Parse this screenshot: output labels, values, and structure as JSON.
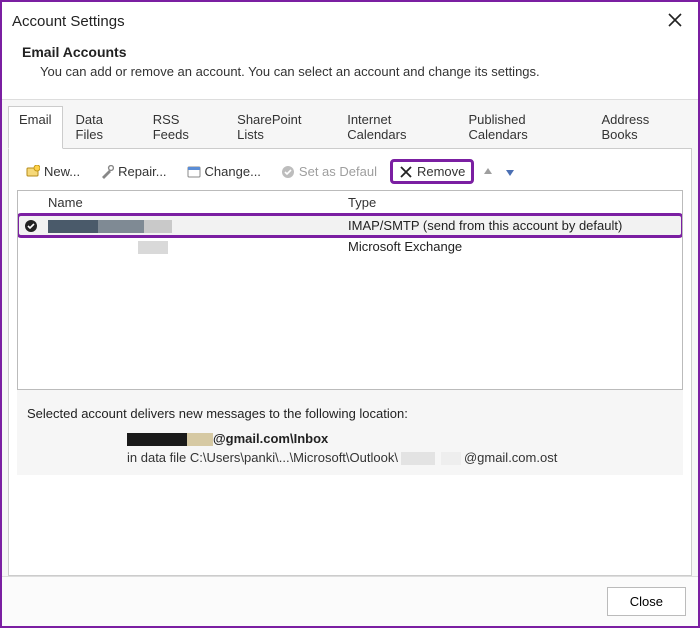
{
  "window": {
    "title": "Account Settings"
  },
  "header": {
    "heading": "Email Accounts",
    "sub": "You can add or remove an account. You can select an account and change its settings."
  },
  "tabs": [
    {
      "label": "Email",
      "active": true
    },
    {
      "label": "Data Files"
    },
    {
      "label": "RSS Feeds"
    },
    {
      "label": "SharePoint Lists"
    },
    {
      "label": "Internet Calendars"
    },
    {
      "label": "Published Calendars"
    },
    {
      "label": "Address Books"
    }
  ],
  "toolbar": {
    "new": "New...",
    "repair": "Repair...",
    "change": "Change...",
    "set_default": "Set as Defaul",
    "remove": "Remove",
    "move_up_icon": "arrow-up",
    "move_down_icon": "arrow-down"
  },
  "columns": {
    "name": "Name",
    "type": "Type"
  },
  "accounts": [
    {
      "default": true,
      "name_redacted": true,
      "type": "IMAP/SMTP (send from this account by default)",
      "selected": true,
      "highlighted": true
    },
    {
      "default": false,
      "name_redacted": true,
      "type": "Microsoft Exchange",
      "selected": false,
      "highlighted": false
    }
  ],
  "info": {
    "line1": "Selected account delivers new messages to the following location:",
    "inbox_suffix": "@gmail.com\\Inbox",
    "datafile_prefix": "in data file C:\\Users\\panki\\...\\Microsoft\\Outlook\\",
    "datafile_suffix": "@gmail.com.ost"
  },
  "footer": {
    "close": "Close"
  },
  "colors": {
    "highlight": "#7b1fa2"
  }
}
